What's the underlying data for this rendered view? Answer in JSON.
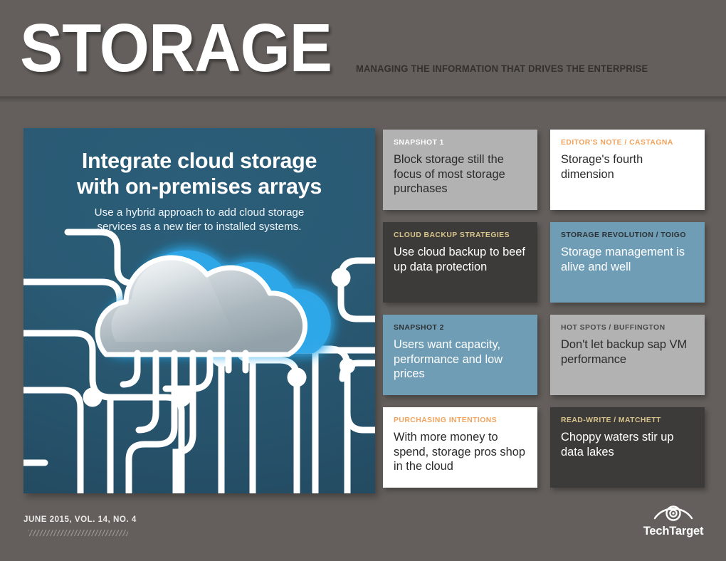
{
  "masthead": {
    "title": "STORAGE",
    "tagline": "MANAGING THE INFORMATION THAT DRIVES THE ENTERPRISE"
  },
  "cover": {
    "headline_line1": "Integrate cloud storage",
    "headline_line2": "with on-premises arrays",
    "subhead_line1": "Use a hybrid approach to add cloud storage",
    "subhead_line2": "services as a new tier to installed systems.",
    "artwork": "cloud-circuit-illustration"
  },
  "cards": [
    {
      "kicker": "SNAPSHOT 1",
      "headline": "Block storage still the focus of most storage purchases",
      "style": "gray",
      "kicker_color": "#ffffff",
      "text_color": "#2b2b2b"
    },
    {
      "kicker": "EDITOR'S NOTE / CASTAGNA",
      "headline": "Storage's fourth dimension",
      "style": "white",
      "kicker_color": "#f2a25c",
      "text_color": "#2b2b2b"
    },
    {
      "kicker": "CLOUD BACKUP STRATEGIES",
      "headline": "Use cloud backup to beef up data protection",
      "style": "dark",
      "kicker_color": "#d8c48a",
      "text_color": "#ffffff"
    },
    {
      "kicker": "STORAGE REVOLUTION / TOIGO",
      "headline": "Storage management is alive and well",
      "style": "blue",
      "kicker_color": "#2d3133",
      "text_color": "#ffffff"
    },
    {
      "kicker": "SNAPSHOT 2",
      "headline": "Users want capacity, performance and low prices",
      "style": "blue",
      "kicker_color": "#2d3133",
      "text_color": "#ffffff"
    },
    {
      "kicker": "HOT SPOTS / BUFFINGTON",
      "headline": "Don't let backup sap VM performance",
      "style": "gray",
      "kicker_color": "#4a4a4a",
      "text_color": "#2b2b2b"
    },
    {
      "kicker": "PURCHASING INTENTIONS",
      "headline": "With more money to spend, storage pros shop in the cloud",
      "style": "white",
      "kicker_color": "#f2a25c",
      "text_color": "#2b2b2b"
    },
    {
      "kicker": "READ-WRITE / MATCHETT",
      "headline": "Choppy waters stir up data lakes",
      "style": "dark",
      "kicker_color": "#d8c48a",
      "text_color": "#ffffff"
    }
  ],
  "footer": {
    "issue": "JUNE 2015, VOL. 14, NO. 4",
    "brand": "TechTarget",
    "brand_icon": "eye-target-icon"
  },
  "colors": {
    "page_background": "#645f5c",
    "cover_blue": "#2a5a74",
    "card_gray": "#b2b2b2",
    "card_dark": "#3d3b39",
    "card_blue": "#6e9db5",
    "accent_orange": "#f2a25c",
    "accent_tan": "#d8c48a"
  }
}
